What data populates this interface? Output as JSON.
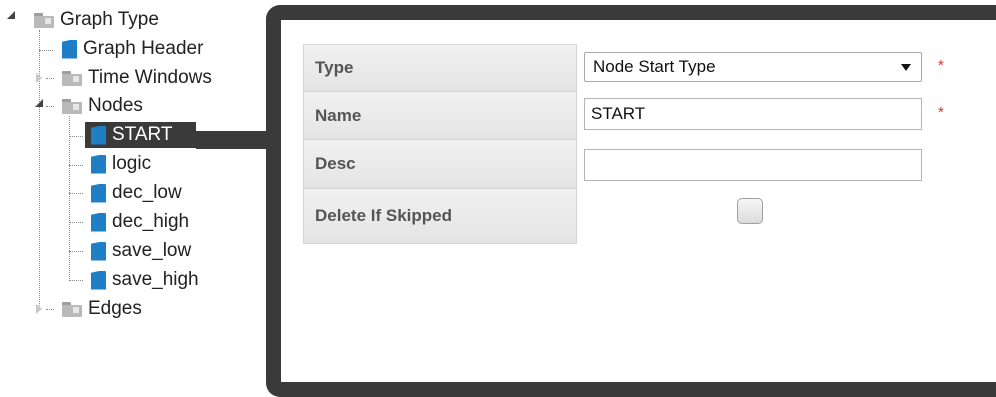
{
  "tree": {
    "root": {
      "label": "Graph Type",
      "icon": "folder-icon",
      "state": "expanded"
    },
    "children": [
      {
        "label": "Graph Header",
        "icon": "document-icon"
      },
      {
        "label": "Time Windows",
        "icon": "folder-icon",
        "state": "collapsed"
      },
      {
        "label": "Nodes",
        "icon": "folder-icon",
        "state": "expanded",
        "children": [
          {
            "label": "START",
            "icon": "document-icon",
            "selected": true
          },
          {
            "label": "logic",
            "icon": "document-icon"
          },
          {
            "label": "dec_low",
            "icon": "document-icon"
          },
          {
            "label": "dec_high",
            "icon": "document-icon"
          },
          {
            "label": "save_low",
            "icon": "document-icon"
          },
          {
            "label": "save_high",
            "icon": "document-icon"
          }
        ]
      },
      {
        "label": "Edges",
        "icon": "folder-icon",
        "state": "collapsed"
      }
    ]
  },
  "form": {
    "type": {
      "label": "Type",
      "value": "Node Start Type",
      "required_mark": "*"
    },
    "name": {
      "label": "Name",
      "value": "START",
      "required_mark": "*"
    },
    "desc": {
      "label": "Desc",
      "value": ""
    },
    "delete_if_skipped": {
      "label": "Delete If Skipped",
      "checked": false
    }
  },
  "colors": {
    "selection": "#3a3a3a",
    "document_icon": "#1e7fc6",
    "required": "#e03030"
  }
}
